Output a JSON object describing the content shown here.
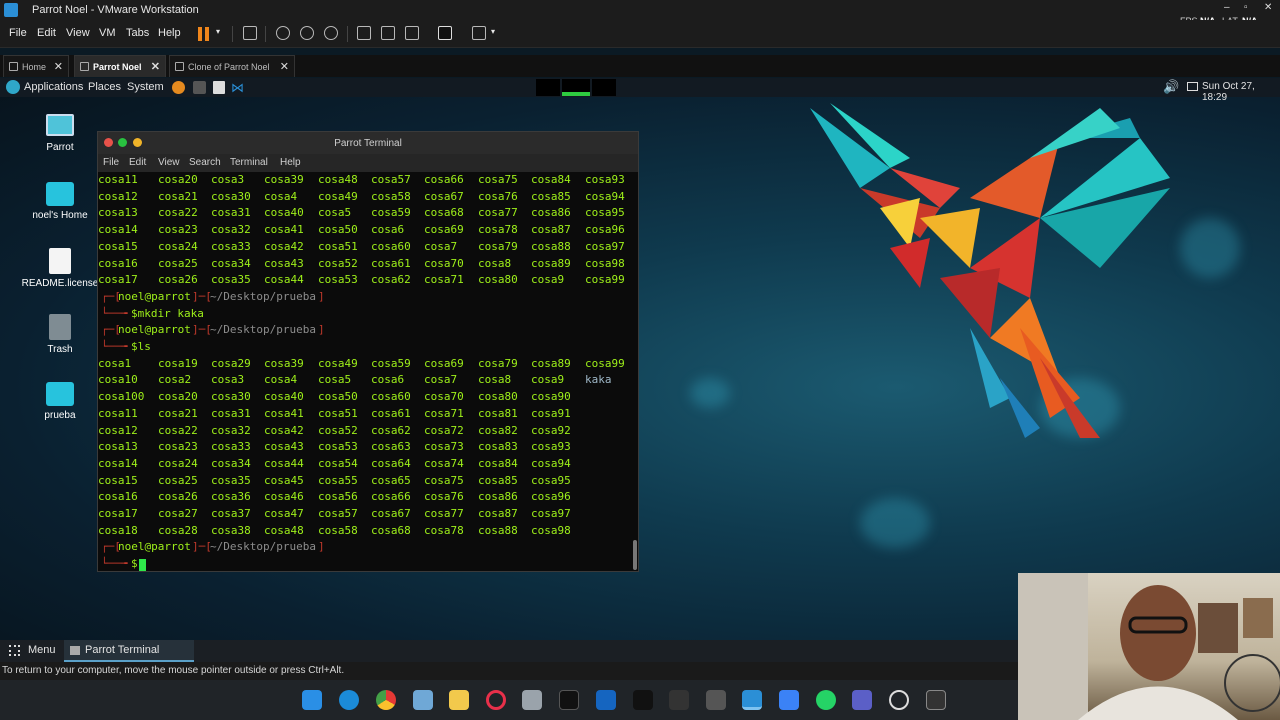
{
  "vm": {
    "title": "Parrot Noel - VMware Workstation",
    "fps_label": "FPS",
    "fps_value": "N/A",
    "lat_label": "LAT",
    "lat_value": "N/A",
    "menu": [
      "File",
      "Edit",
      "View",
      "VM",
      "Tabs",
      "Help"
    ],
    "tabs": [
      {
        "label": "Home",
        "active": false
      },
      {
        "label": "Parrot Noel",
        "active": true
      },
      {
        "label": "Clone of Parrot Noel",
        "active": false
      }
    ],
    "status": "To return to your computer, move the mouse pointer outside or press Ctrl+Alt."
  },
  "guest_panel": {
    "applications": "Applications",
    "places": "Places",
    "system": "System",
    "clock": "Sun Oct 27, 18:29"
  },
  "desktop_icons": [
    {
      "label": "Parrot",
      "icon": "monitor-icon"
    },
    {
      "label": "noel's Home",
      "icon": "home-folder-icon"
    },
    {
      "label": "README.license",
      "icon": "document-icon"
    },
    {
      "label": "Trash",
      "icon": "trash-icon"
    },
    {
      "label": "prueba",
      "icon": "folder-icon"
    }
  ],
  "terminal": {
    "title": "Parrot Terminal",
    "menu": [
      "File",
      "Edit",
      "View",
      "Search",
      "Terminal",
      "Help"
    ],
    "top_rows": [
      [
        "cosa11",
        "cosa20",
        "cosa3",
        "cosa39",
        "cosa48",
        "cosa57",
        "cosa66",
        "cosa75",
        "cosa84",
        "cosa93"
      ],
      [
        "cosa12",
        "cosa21",
        "cosa30",
        "cosa4",
        "cosa49",
        "cosa58",
        "cosa67",
        "cosa76",
        "cosa85",
        "cosa94"
      ],
      [
        "cosa13",
        "cosa22",
        "cosa31",
        "cosa40",
        "cosa5",
        "cosa59",
        "cosa68",
        "cosa77",
        "cosa86",
        "cosa95"
      ],
      [
        "cosa14",
        "cosa23",
        "cosa32",
        "cosa41",
        "cosa50",
        "cosa6",
        "cosa69",
        "cosa78",
        "cosa87",
        "cosa96"
      ],
      [
        "cosa15",
        "cosa24",
        "cosa33",
        "cosa42",
        "cosa51",
        "cosa60",
        "cosa7",
        "cosa79",
        "cosa88",
        "cosa97"
      ],
      [
        "cosa16",
        "cosa25",
        "cosa34",
        "cosa43",
        "cosa52",
        "cosa61",
        "cosa70",
        "cosa8",
        "cosa89",
        "cosa98"
      ],
      [
        "cosa17",
        "cosa26",
        "cosa35",
        "cosa44",
        "cosa53",
        "cosa62",
        "cosa71",
        "cosa80",
        "cosa9",
        "cosa99"
      ]
    ],
    "prompt_user": "noel@parrot",
    "prompt_path": "~/Desktop/prueba",
    "cmd1": "$mkdir kaka",
    "cmd2": "$ls",
    "cmd3": "$",
    "ls_rows": [
      [
        "cosa1",
        "cosa19",
        "cosa29",
        "cosa39",
        "cosa49",
        "cosa59",
        "cosa69",
        "cosa79",
        "cosa89",
        "cosa99"
      ],
      [
        "cosa10",
        "cosa2",
        "cosa3",
        "cosa4",
        "cosa5",
        "cosa6",
        "cosa7",
        "cosa8",
        "cosa9",
        "kaka"
      ],
      [
        "cosa100",
        "cosa20",
        "cosa30",
        "cosa40",
        "cosa50",
        "cosa60",
        "cosa70",
        "cosa80",
        "cosa90",
        ""
      ],
      [
        "cosa11",
        "cosa21",
        "cosa31",
        "cosa41",
        "cosa51",
        "cosa61",
        "cosa71",
        "cosa81",
        "cosa91",
        ""
      ],
      [
        "cosa12",
        "cosa22",
        "cosa32",
        "cosa42",
        "cosa52",
        "cosa62",
        "cosa72",
        "cosa82",
        "cosa92",
        ""
      ],
      [
        "cosa13",
        "cosa23",
        "cosa33",
        "cosa43",
        "cosa53",
        "cosa63",
        "cosa73",
        "cosa83",
        "cosa93",
        ""
      ],
      [
        "cosa14",
        "cosa24",
        "cosa34",
        "cosa44",
        "cosa54",
        "cosa64",
        "cosa74",
        "cosa84",
        "cosa94",
        ""
      ],
      [
        "cosa15",
        "cosa25",
        "cosa35",
        "cosa45",
        "cosa55",
        "cosa65",
        "cosa75",
        "cosa85",
        "cosa95",
        ""
      ],
      [
        "cosa16",
        "cosa26",
        "cosa36",
        "cosa46",
        "cosa56",
        "cosa66",
        "cosa76",
        "cosa86",
        "cosa96",
        ""
      ],
      [
        "cosa17",
        "cosa27",
        "cosa37",
        "cosa47",
        "cosa57",
        "cosa67",
        "cosa77",
        "cosa87",
        "cosa97",
        ""
      ],
      [
        "cosa18",
        "cosa28",
        "cosa38",
        "cosa48",
        "cosa58",
        "cosa68",
        "cosa78",
        "cosa88",
        "cosa98",
        ""
      ]
    ]
  },
  "guest_bottom": {
    "menu": "Menu",
    "task": "Parrot Terminal"
  },
  "colors": {
    "terminal_green": "#9ef01a",
    "prompt_red": "#c0392b",
    "pause_orange": "#f0861b"
  }
}
